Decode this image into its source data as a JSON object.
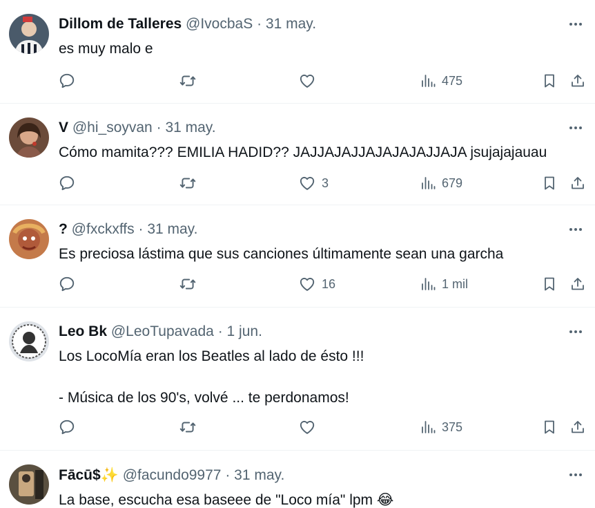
{
  "tweets": [
    {
      "name": "Dillom de Talleres",
      "handle": "@IvocbaS",
      "date": "31 may.",
      "text": "es muy malo e",
      "counts": {
        "replies": "",
        "retweets": "",
        "likes": "",
        "views": "475"
      }
    },
    {
      "name": "V",
      "handle": "@hi_soyvan",
      "date": "31 may.",
      "text": "Cómo mamita??? EMILIA HADID?? JAJJAJAJJAJAJAJAJJAJA jsujajajauau",
      "counts": {
        "replies": "",
        "retweets": "",
        "likes": "3",
        "views": "679"
      }
    },
    {
      "name": "?",
      "handle": "@fxckxffs",
      "date": "31 may.",
      "text": "Es preciosa lástima que sus canciones últimamente sean una garcha",
      "counts": {
        "replies": "",
        "retweets": "",
        "likes": "16",
        "views": "1 mil"
      }
    },
    {
      "name": "Leo Bk",
      "handle": "@LeoTupavada",
      "date": "1 jun.",
      "text": "Los LocoMía eran los Beatles al lado de ésto !!!\n\n- Música de los 90's, volvé ... te perdonamos!",
      "counts": {
        "replies": "",
        "retweets": "",
        "likes": "",
        "views": "375"
      }
    },
    {
      "name": "Fācū$",
      "name_emoji": "✨",
      "handle": "@facundo9977",
      "date": "31 may.",
      "text": "La base, escucha esa baseee de \"Loco mía\" lpm",
      "text_emoji": "😂",
      "counts": {
        "replies": "",
        "retweets": "",
        "likes": "",
        "views": ""
      }
    }
  ],
  "separator": "·",
  "icons": {
    "reply": "reply-icon",
    "retweet": "retweet-icon",
    "like": "heart-icon",
    "views": "views-icon",
    "bookmark": "bookmark-icon",
    "share": "share-icon",
    "more": "more-icon"
  },
  "colors": {
    "text": "#0f1419",
    "secondary": "#536471",
    "divider": "#eff3f4"
  }
}
